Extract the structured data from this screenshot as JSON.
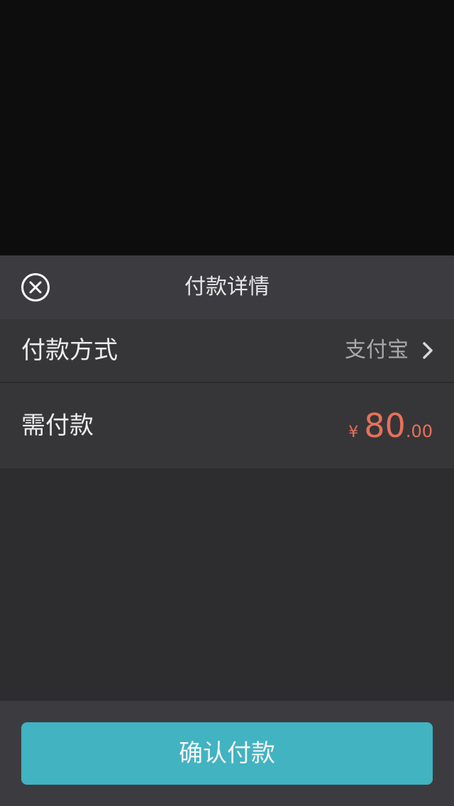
{
  "sheet": {
    "title": "付款详情",
    "close_icon": "close-circle-icon"
  },
  "payment_method": {
    "label": "付款方式",
    "value": "支付宝",
    "chevron_icon": "chevron-right-icon"
  },
  "amount_due": {
    "label": "需付款",
    "currency": "¥",
    "integer": "80",
    "decimal": ".00",
    "color": "#e8705a"
  },
  "confirm_button": {
    "label": "确认付款",
    "color": "#41b3c1"
  }
}
